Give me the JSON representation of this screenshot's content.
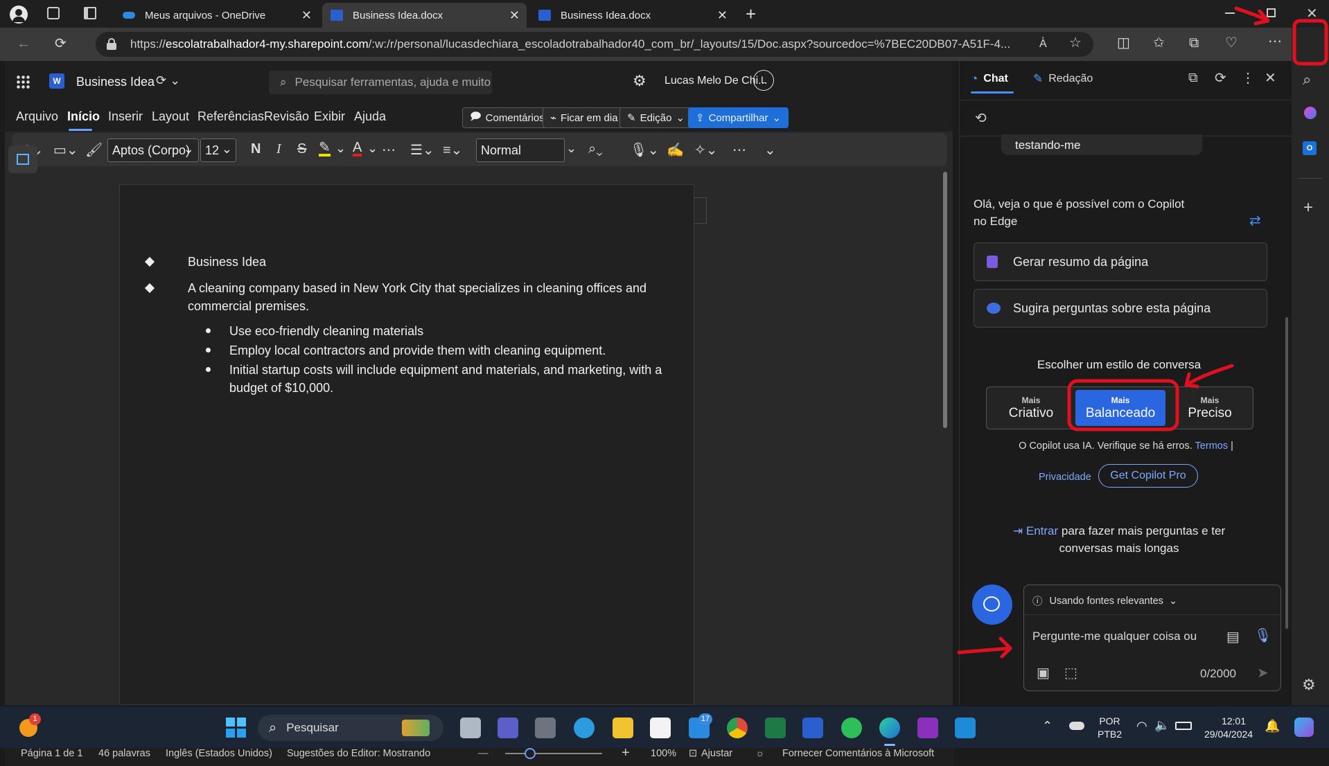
{
  "browser": {
    "tabs": [
      {
        "label": "Meus arquivos - OneDrive"
      },
      {
        "label": "Business Idea.docx"
      },
      {
        "label": "Business Idea.docx"
      }
    ],
    "url_prefix": "https://",
    "url_host": "escolatrabalhador4-my.sharepoint.com",
    "url_path": "/:w:/r/personal/lucasdechiara_escoladotrabalhador40_com_br/_layouts/15/Doc.aspx?sourcedoc=%7BEC20DB07-A51F-4..."
  },
  "word": {
    "doc_title": "Business Idea",
    "search_placeholder": "Pesquisar ferramentas, ajuda e muito mais (Alt + Q)",
    "user_name": "Lucas Melo De Chi...",
    "user_initial": "L",
    "menu": [
      "Arquivo",
      "Início",
      "Inserir",
      "Layout",
      "Referências",
      "Revisão",
      "Exibir",
      "Ajuda"
    ],
    "comments_label": "Comentários",
    "catchup_label": "Ficar em dia",
    "editing_label": "Edição",
    "share_label": "Compartilhar",
    "font_name": "Aptos (Corpo)",
    "font_size": "12",
    "bold_glyph": "N",
    "italic_glyph": "I",
    "strike_glyph": "S",
    "style_name": "Normal",
    "document": {
      "bullet_1": "Business Idea",
      "bullet_2_line1": "A cleaning company based in New York City that specializes in cleaning offices and",
      "bullet_2_line2": "commercial premises.",
      "sub_1": "Use eco-friendly cleaning materials",
      "sub_2": "Employ local contractors and provide them with cleaning equipment.",
      "sub_3_line1": "Initial startup costs will include equipment and materials, and marketing, with a",
      "sub_3_line2": "budget of $10,000."
    },
    "status": {
      "page": "Página 1 de 1",
      "words": "46 palavras",
      "language": "Inglês (Estados Unidos)",
      "editor": "Sugestões do Editor: Mostrando",
      "zoom_minus": "—",
      "zoom_plus": "+",
      "zoom": "100%",
      "fit": "Ajustar",
      "feedback": "Fornecer Comentários à Microsoft"
    }
  },
  "copilot": {
    "tab_chat": "Chat",
    "tab_compose": "Redação",
    "prev_message": "testando-me",
    "greeting": "Olá, veja o que é possível com o Copilot no Edge",
    "action_summary": "Gerar resumo da página",
    "action_questions": "Sugira perguntas sobre esta página",
    "style_heading": "Escolher um estilo de conversa",
    "styles": [
      {
        "top": "Mais",
        "name": "Criativo"
      },
      {
        "top": "Mais",
        "name": "Balanceado"
      },
      {
        "top": "Mais",
        "name": "Preciso"
      }
    ],
    "disclaimer": "O Copilot usa IA. Verifique se há erros.",
    "terms_link": "Termos",
    "privacy_link": "Privacidade",
    "pro_button": "Get Copilot Pro",
    "signin_link": "Entrar",
    "signin_rest": "para fazer mais perguntas e ter",
    "signin_line2": "conversas mais longas",
    "sources_label": "Usando fontes relevantes",
    "input_placeholder": "Pergunte-me qualquer coisa ou",
    "char_count": "0/2000"
  },
  "taskbar": {
    "search_label": "Pesquisar",
    "notif_count": "1",
    "mail_badge": "17",
    "lang1": "POR",
    "lang2": "PTB2",
    "time": "12:01",
    "date": "29/04/2024"
  },
  "colors": {
    "accent": "#2a66e0",
    "share_button": "#1e6fd9",
    "annotation_red": "#e01020",
    "link": "#7fa8ff"
  }
}
